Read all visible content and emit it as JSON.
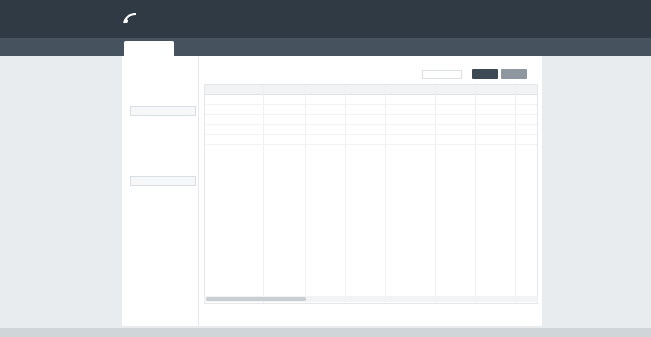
{
  "header": {
    "brand": "",
    "brand_sub": "",
    "controls": [
      "",
      ""
    ]
  },
  "tabs": [
    {
      "label": "",
      "active": true
    },
    {
      "label": "",
      "active": false
    },
    {
      "label": "",
      "active": false
    },
    {
      "label": "",
      "active": false
    },
    {
      "label": "",
      "active": false
    },
    {
      "label": "",
      "active": false
    },
    {
      "label": "",
      "active": false
    }
  ],
  "sidebar": {
    "items": [
      {
        "label": "",
        "level": 0
      },
      {
        "label": "",
        "level": 0
      },
      {
        "label": "",
        "level": 1
      },
      {
        "label": "",
        "level": 1
      },
      {
        "label": "",
        "level": 1
      },
      {
        "label": "",
        "level": 1
      },
      {
        "label": "",
        "level": 0
      },
      {
        "label": "",
        "level": 1
      },
      {
        "label": "",
        "level": 1
      },
      {
        "label": "",
        "level": 1
      }
    ]
  },
  "content": {
    "title": "",
    "search_placeholder": "",
    "primary_button": "",
    "secondary_button": ""
  },
  "table": {
    "columns": [
      "",
      "",
      "",
      "",
      "",
      "",
      "",
      "",
      ""
    ],
    "rows": [
      [
        "",
        "",
        "",
        "",
        "",
        "",
        "",
        "",
        ""
      ],
      [
        "",
        "",
        "",
        "",
        "",
        "",
        "",
        "",
        ""
      ],
      [
        "",
        "",
        "",
        "",
        "",
        "",
        "",
        "",
        ""
      ],
      [
        "",
        "",
        "",
        "",
        "",
        "",
        "",
        "",
        ""
      ],
      [
        "",
        "",
        "",
        "",
        "",
        "",
        "",
        "",
        ""
      ]
    ]
  },
  "pager": {
    "left": "",
    "right": ""
  },
  "statusbar": {
    "text": ""
  },
  "colors": {
    "header_bg": "#2f3a44",
    "tabbar_bg": "#46535e",
    "page_bg": "#e9ecee",
    "primary_button": "#3d4a55",
    "secondary_button": "#8e979f"
  }
}
